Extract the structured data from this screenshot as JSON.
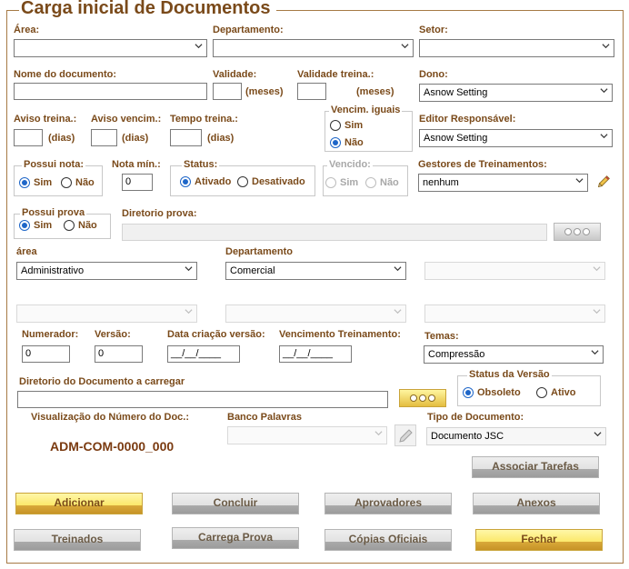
{
  "window": {
    "title": "Carga inicial de Documentos"
  },
  "fields": {
    "area_label": "Área:",
    "departamento_label": "Departamento:",
    "setor_label": "Setor:",
    "area_value": "",
    "departamento_value": "",
    "setor_value": "",
    "nome_label": "Nome do documento:",
    "nome_value": "",
    "validade_label": "Validade:",
    "validade_value": "",
    "validade_unit": "(meses)",
    "validade_treina_label": "Validade treina.:",
    "validade_treina_value": "",
    "validade_treina_unit": "(meses)",
    "dono_label": "Dono:",
    "dono_value": "Asnow Setting",
    "aviso_treina_label": "Aviso treina.:",
    "aviso_treina_value": "",
    "aviso_treina_unit": "(dias)",
    "aviso_vencim_label": "Aviso vencim.:",
    "aviso_vencim_value": "",
    "aviso_vencim_unit": "(dias)",
    "tempo_treina_label": "Tempo treina.:",
    "tempo_treina_value": "",
    "tempo_treina_unit": "(dias)",
    "vencim_iguais_label": "Vencim. iguais",
    "vencim_iguais_sim": "Sim",
    "vencim_iguais_nao": "Não",
    "editor_label": "Editor Responsável:",
    "editor_value": "Asnow Setting",
    "possui_nota_label": "Possui nota:",
    "possui_nota_sim": "Sim",
    "possui_nota_nao": "Não",
    "nota_min_label": "Nota mín.:",
    "nota_min_value": "0",
    "status_label": "Status:",
    "status_ativado": "Ativado",
    "status_desativado": "Desativado",
    "vencido_label": "Vencido:",
    "vencido_sim": "Sim",
    "vencido_nao": "Não",
    "gestores_label": "Gestores de Treinamentos:",
    "gestores_value": "nenhum",
    "possui_prova_label": "Possui prova",
    "possui_prova_sim": "Sim",
    "possui_prova_nao": "Não",
    "diretorio_prova_label": "Diretorio prova:",
    "diretorio_prova_value": "",
    "area2_label": "área",
    "area2_value": "Administrativo",
    "departamento2_label": "Departamento",
    "departamento2_value": "Comercial",
    "numerador_label": "Numerador:",
    "numerador_value": "0",
    "versao_label": "Versão:",
    "versao_value": "0",
    "data_criacao_label": "Data criação versão:",
    "data_criacao_value": "__/__/____",
    "vencimento_treinamento_label": "Vencimento Treinamento:",
    "vencimento_treinamento_value": "__/__/____",
    "temas_label": "Temas:",
    "temas_value": "Compressão",
    "diretorio_doc_label": "Diretorio do Documento a carregar",
    "diretorio_doc_value": "",
    "status_versao_label": "Status da Versão",
    "status_versao_obsoleto": "Obsoleto",
    "status_versao_ativo": "Ativo",
    "visualizacao_label": "Visualização do Número do Doc.:",
    "visualizacao_value": "ADM-COM-0000_000",
    "banco_palavras_label": "Banco Palavras",
    "tipo_documento_label": "Tipo de Documento:",
    "tipo_documento_value": "Documento JSC"
  },
  "buttons": {
    "associar": "Associar Tarefas",
    "adicionar": "Adicionar",
    "concluir": "Concluir",
    "aprovadores": "Aprovadores",
    "anexos": "Anexos",
    "treinados": "Treinados",
    "carrega_prova": "Carrega Prova",
    "copias_oficiais": "Cópias Oficiais",
    "fechar": "Fechar"
  },
  "colors": {
    "label_brown": "#7a4a1a",
    "frame_border": "#a67a45",
    "radio_blue": "#1e66c8",
    "button_yellow": "#fbe86a",
    "button_gray": "#e2e2e2"
  },
  "icons": [
    "chevron-down-icon",
    "ellipsis-icon",
    "pencil-icon"
  ]
}
